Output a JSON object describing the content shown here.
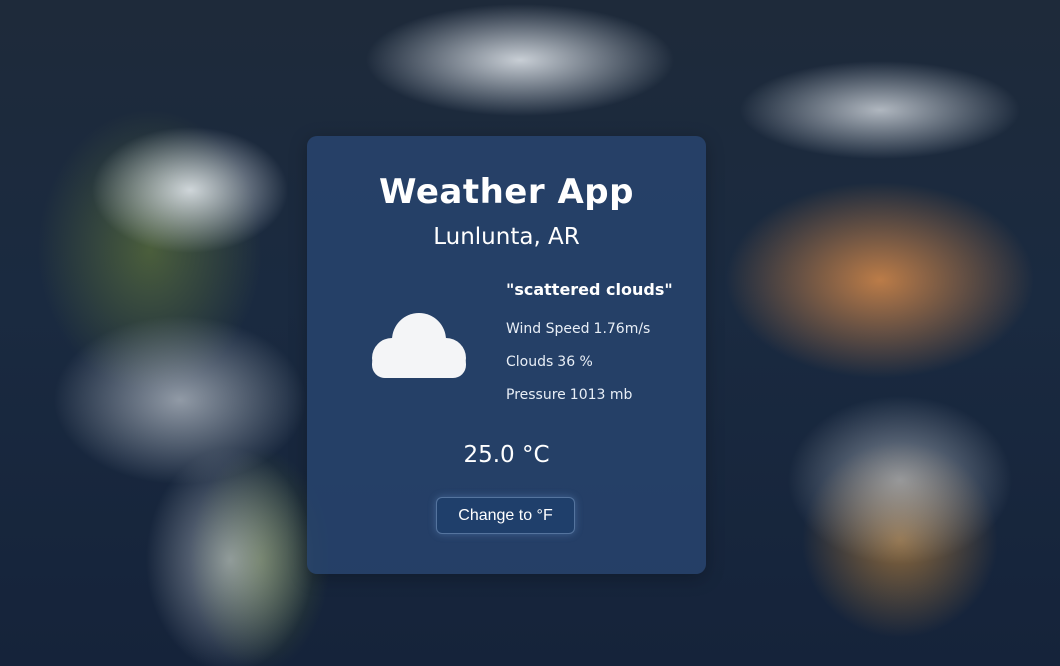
{
  "app": {
    "title": "Weather App",
    "location": "Lunlunta, AR"
  },
  "weather": {
    "description": "\"scattered clouds\"",
    "icon": "cloud-icon",
    "wind_label": "Wind Speed",
    "wind_value": "1.76m/s",
    "clouds_label": "Clouds",
    "clouds_value": "36 %",
    "pressure_label": "Pressure",
    "pressure_value": "1013 mb",
    "temperature": "25.0 °C"
  },
  "controls": {
    "toggle_label": "Change to °F"
  },
  "colors": {
    "card": "#2a4a72",
    "button": "#1f3f6b",
    "text": "#ffffff"
  }
}
